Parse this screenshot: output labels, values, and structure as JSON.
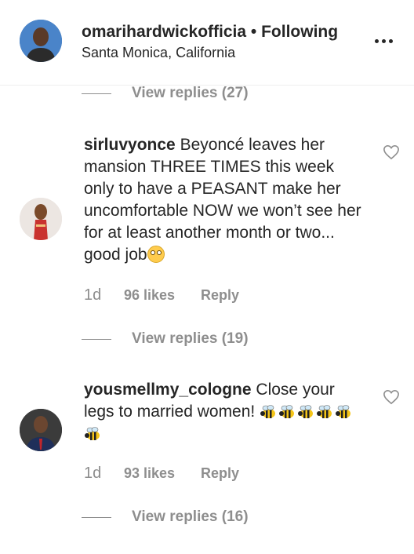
{
  "post_header": {
    "username": "omarihardwickofficia",
    "separator": "•",
    "follow_status": "Following",
    "location": "Santa Monica, California",
    "more_icon": "ellipsis-icon"
  },
  "replies_top": {
    "label": "View replies (27)"
  },
  "comments": [
    {
      "username": "sirluvyonce",
      "text": "Beyoncé leaves her mansion THREE TIMES this week only to have a PEASANT make her uncomfortable NOW we won’t see her for at least another month or two... good job",
      "emoji": "face-with-rolling-eyes",
      "age": "1d",
      "likes": "96 likes",
      "reply_label": "Reply",
      "view_replies": "View replies (19)"
    },
    {
      "username": "yousmellmy_cologne",
      "text": "Close your legs to married women!",
      "emoji": "bee x6",
      "age": "1d",
      "likes": "93 likes",
      "reply_label": "Reply",
      "view_replies": "View replies (16)"
    }
  ],
  "colors": {
    "primary_text": "#262626",
    "secondary_text": "#8e8e8e",
    "divider": "#efefef"
  }
}
